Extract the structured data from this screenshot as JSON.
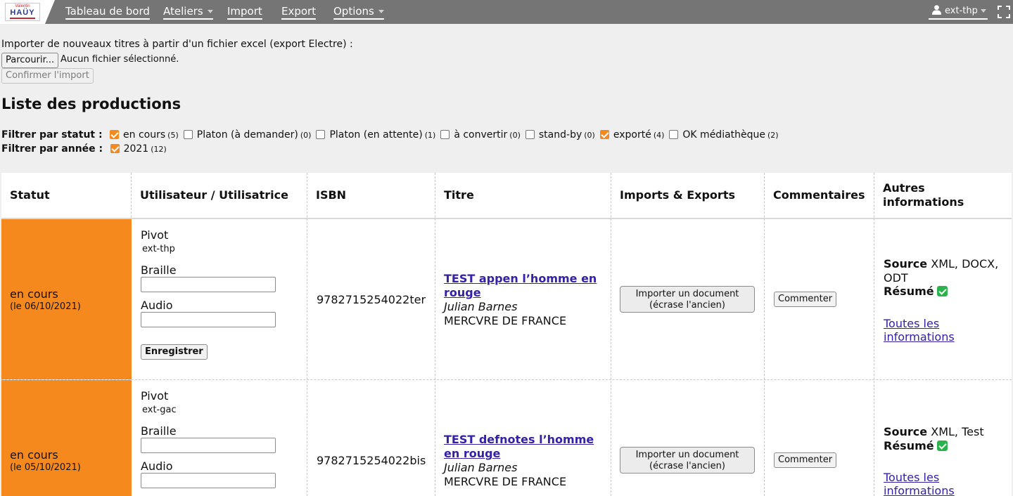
{
  "logo": {
    "small": "Valentin",
    "big": "HAÜY"
  },
  "nav": {
    "items": [
      {
        "label": "Tableau de bord"
      },
      {
        "label": "Ateliers"
      },
      {
        "label": "Import"
      },
      {
        "label": "Export"
      },
      {
        "label": "Options"
      }
    ],
    "user": "ext-thp"
  },
  "import": {
    "title": "Importer de nouveaux titres à partir d'un fichier excel (export Electre) :",
    "browse_label": "Parcourir...",
    "file_status": "Aucun fichier sélectionné.",
    "confirm_label": "Confirmer l'import"
  },
  "list_title": "Liste des productions",
  "filters": {
    "status_label": "Filtrer par statut :",
    "status": [
      {
        "label": "en cours",
        "count": "(5)",
        "checked": true
      },
      {
        "label": "Platon (à demander)",
        "count": "(0)",
        "checked": false
      },
      {
        "label": "Platon (en attente)",
        "count": "(1)",
        "checked": false
      },
      {
        "label": "à convertir",
        "count": "(0)",
        "checked": false
      },
      {
        "label": "stand-by",
        "count": "(0)",
        "checked": false
      },
      {
        "label": "exporté",
        "count": "(4)",
        "checked": true
      },
      {
        "label": "OK médiathèque",
        "count": "(2)",
        "checked": false
      }
    ],
    "year_label": "Filtrer par année :",
    "years": [
      {
        "label": "2021",
        "count": "(12)",
        "checked": true
      }
    ]
  },
  "table": {
    "headers": [
      "Statut",
      "Utilisateur / Utilisatrice",
      "ISBN",
      "Titre",
      "Imports & Exports",
      "Commentaires",
      "Autres informations"
    ],
    "user_labels": {
      "pivot": "Pivot",
      "braille": "Braille",
      "audio": "Audio",
      "save": "Enregistrer"
    },
    "import_button": [
      "Importer un document",
      "(écrase l'ancien)"
    ],
    "comment_button": "Commenter",
    "source_label": "Source",
    "summary_label": "Résumé",
    "more_info": [
      "Toutes les",
      "informations"
    ],
    "rows": [
      {
        "status": "en cours",
        "date": "(le 06/10/2021)",
        "pivot_user": "ext-thp",
        "isbn": "9782715254022ter",
        "title": "TEST appen l’homme en rouge",
        "author": "Julian Barnes",
        "publisher": "MERCVRE DE FRANCE",
        "source": "XML, DOCX, ODT"
      },
      {
        "status": "en cours",
        "date": "(le 05/10/2021)",
        "pivot_user": "ext-gac",
        "isbn": "9782715254022bis",
        "title": "TEST defnotes l’homme en rouge",
        "author": "Julian Barnes",
        "publisher": "MERCVRE DE FRANCE",
        "source": "XML, Test"
      }
    ]
  },
  "colors": {
    "topbar": "#757575",
    "status_orange": "#f5891d",
    "link": "#3321a8",
    "check_green": "#2bb24c"
  }
}
